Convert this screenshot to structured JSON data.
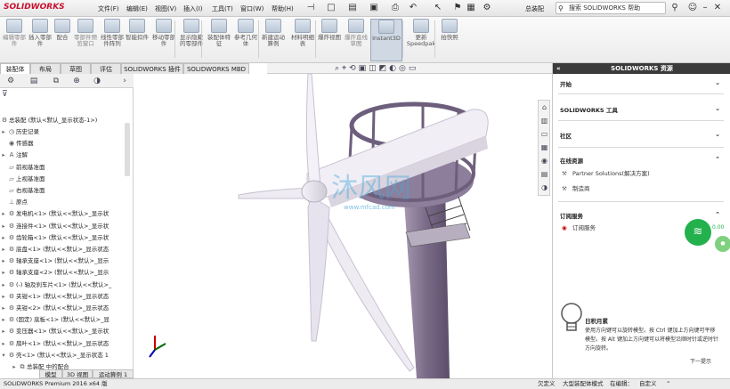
{
  "app": {
    "logo": "SOLIDWORKS",
    "doc_title": "总装配",
    "help_placeholder": "搜索 SOLIDWORKS 帮助"
  },
  "menu": [
    "文件(F)",
    "编辑(E)",
    "视图(V)",
    "插入(I)",
    "工具(T)",
    "窗口(W)",
    "帮助(H)"
  ],
  "commands": [
    {
      "label": "编辑零部件",
      "dim": true
    },
    {
      "label": "插入零部件",
      "dim": false
    },
    {
      "label": "配合",
      "dim": false
    },
    {
      "label": "零部件预览窗口",
      "dim": true
    },
    {
      "label": "线性零部件阵列",
      "dim": false
    },
    {
      "label": "智能扣件",
      "dim": false
    },
    {
      "label": "移动零部件",
      "dim": false
    },
    {
      "label": "显示隐藏的零部件",
      "dim": false
    },
    {
      "label": "装配体特征",
      "dim": false
    },
    {
      "label": "参考几何体",
      "dim": false
    },
    {
      "label": "新建运动算例",
      "dim": false
    },
    {
      "label": "材料明细表",
      "dim": false
    },
    {
      "label": "爆炸视图",
      "dim": false
    },
    {
      "label": "爆炸直线草图",
      "dim": true
    },
    {
      "label": "Instant3D",
      "dim": false,
      "active": true
    },
    {
      "label": "更新Speedpak",
      "dim": false
    },
    {
      "label": "拍快照",
      "dim": false
    }
  ],
  "tabs": [
    "装配体",
    "布局",
    "草图",
    "评估",
    "SOLIDWORKS 插件",
    "SOLIDWORKS MBD"
  ],
  "tree": {
    "root": "总装配  (默认<默认_显示状态-1>)",
    "items": [
      {
        "label": "历史记录",
        "icon": "history-icon",
        "glyph": "◷",
        "exp": "▸"
      },
      {
        "label": "传感器",
        "icon": "sensor-icon",
        "glyph": "◉",
        "exp": ""
      },
      {
        "label": "注解",
        "icon": "annotation-icon",
        "glyph": "A",
        "exp": "▸"
      },
      {
        "label": "前视基准面",
        "icon": "plane-icon",
        "glyph": "▱",
        "exp": ""
      },
      {
        "label": "上视基准面",
        "icon": "plane-icon",
        "glyph": "▱",
        "exp": ""
      },
      {
        "label": "右视基准面",
        "icon": "plane-icon",
        "glyph": "▱",
        "exp": ""
      },
      {
        "label": "原点",
        "icon": "origin-icon",
        "glyph": "⊥",
        "exp": ""
      },
      {
        "label": "发电机<1> (默认<<默认>_显示状",
        "icon": "part-icon",
        "glyph": "⚙",
        "exp": "▸"
      },
      {
        "label": "连接件<1> (默认<<默认>_显示状",
        "icon": "part-icon",
        "glyph": "⚙",
        "exp": "▸"
      },
      {
        "label": "齿轮箱<1> (默认<<默认>_显示状",
        "icon": "part-icon",
        "glyph": "⚙",
        "exp": "▸"
      },
      {
        "label": "底盘<1> (默认<<默认>_显示状态",
        "icon": "part-icon",
        "glyph": "⚙",
        "exp": "▸"
      },
      {
        "label": "轴承支座<1> (默认<<默认>_显示",
        "icon": "part-icon",
        "glyph": "⚙",
        "exp": "▸"
      },
      {
        "label": "轴承支座<2> (默认<<默认>_显示",
        "icon": "part-icon",
        "glyph": "⚙",
        "exp": "▸"
      },
      {
        "label": "(-) 轴及刹车片<1> (默认<<默认>_",
        "icon": "part-icon",
        "glyph": "⚙",
        "exp": "▸"
      },
      {
        "label": "夹钳<1> (默认<<默认>_显示状态",
        "icon": "part-icon",
        "glyph": "⚙",
        "exp": "▸"
      },
      {
        "label": "夹钳<2> (默认<<默认>_显示状态",
        "icon": "part-icon",
        "glyph": "⚙",
        "exp": "▸"
      },
      {
        "label": "(固定) 底板<1> (默认<<默认>_显",
        "icon": "part-icon",
        "glyph": "⚙",
        "exp": "▸"
      },
      {
        "label": "变压器<1> (默认<<默认>_显示状",
        "icon": "part-icon",
        "glyph": "⚙",
        "exp": "▸"
      },
      {
        "label": "扇叶<1> (默认<<默认>_显示状态",
        "icon": "part-icon",
        "glyph": "⚙",
        "exp": "▸"
      },
      {
        "label": "壳<1> (默认<<默认>_显示状态 1",
        "icon": "part-icon",
        "glyph": "⚙",
        "exp": "▾"
      },
      {
        "label": "总装配 中的配合",
        "icon": "mates-icon",
        "glyph": "⧉",
        "exp": "▸"
      }
    ]
  },
  "bottom_tabs": [
    "模型",
    "3D 视图",
    "运动算例 1"
  ],
  "resources": {
    "title": "SOLIDWORKS 资源",
    "sections": [
      "开始",
      "SOLIDWORKS 工具",
      "社区",
      "在线资源",
      "订阅服务"
    ],
    "online_links": [
      "Partner Solutions(解决方案)",
      "制造商"
    ],
    "subscription_links": [
      "订阅服务"
    ],
    "tip": {
      "title": "日积月累",
      "body": "使用方向键可以旋转模型。按 Ctrl 键加上方向键可平移模型。按 Alt 键加上方向键可以将模型沿顺时针或逆时针方向旋转。",
      "next": "下一提示"
    }
  },
  "status": {
    "left": "SOLIDWORKS Premium 2016 x64 版",
    "under_defined": "欠定义",
    "large_mode": "大型装配体模式",
    "editing": "在编辑：",
    "custom": "自定义"
  },
  "watermark": {
    "main": "沐风网",
    "url": "www.mfcad.com"
  },
  "badge": {
    "value": "0.00"
  },
  "colors": {
    "accent": "#c8102e",
    "model": "#8a7a95",
    "badge": "#23b14d"
  }
}
